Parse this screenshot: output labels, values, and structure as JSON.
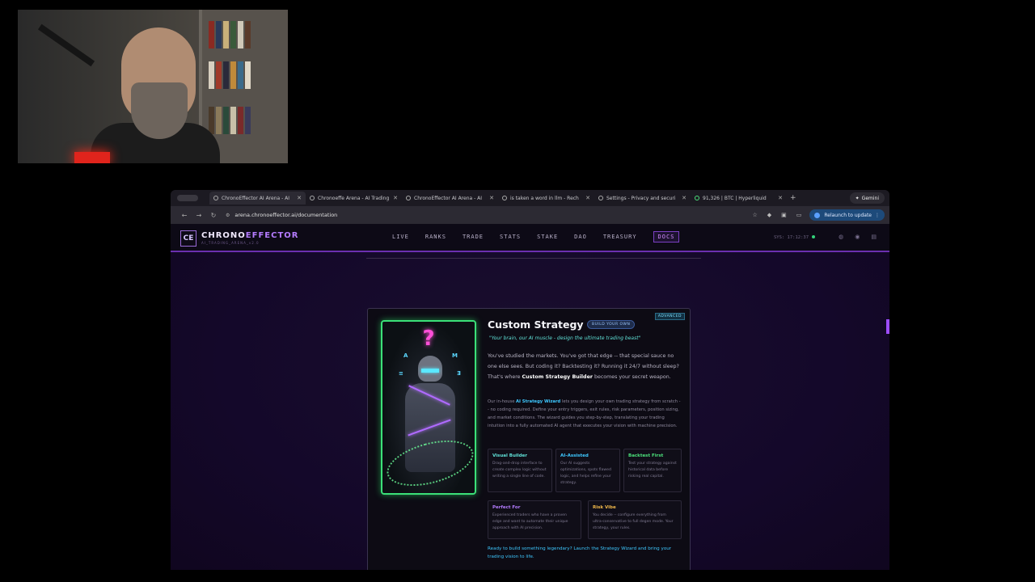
{
  "browser": {
    "tabs": [
      {
        "title": "ChronoEffector AI Arena - AI",
        "active": true
      },
      {
        "title": "Chronoeffe Arena - AI Trading",
        "active": false
      },
      {
        "title": "ChronoEffector AI Arena - AI",
        "active": false
      },
      {
        "title": "is taken a word in llm - Rech",
        "active": false
      },
      {
        "title": "Settings - Privacy and securi",
        "active": false
      },
      {
        "title": "91,326 | BTC | Hyperliquid",
        "active": false
      }
    ],
    "new_tab": "+",
    "gemini_label": "Gemini",
    "url": "arena.chronoeffector.ai/documentation",
    "relaunch_label": "Relaunch to update"
  },
  "site": {
    "logo_mark": "CE",
    "logo_main": "CHRONO",
    "logo_accent": "EFFECTOR",
    "logo_sub": "AI_TRADING_ARENA_v2.0",
    "menu": [
      "LIVE",
      "RANKS",
      "TRADE",
      "STATS",
      "STAKE",
      "DAO",
      "TREASURY",
      "DOCS"
    ],
    "active_menu": "DOCS",
    "sys_time": "SYS: 17:12:37"
  },
  "card": {
    "level_badge": "ADVANCED",
    "title": "Custom Strategy",
    "title_badge": "BUILD YOUR OWN",
    "tagline": "\"Your brain, our AI muscle - design the ultimate trading beast\"",
    "intro_1": "You've studied the markets. You've got that edge -- that special sauce no one else sees. But coding it? Backtesting it? Running it 24/7 without sleep? That's where ",
    "intro_bold": "Custom Strategy Builder",
    "intro_2": " becomes your secret weapon.",
    "wizard_1": "Our in-house ",
    "wizard_bold": "AI Strategy Wizard",
    "wizard_2": " lets you design your own trading strategy from scratch -- no coding required. Define your entry triggers, exit rules, risk parameters, position sizing, and market conditions. The wizard guides you step-by-step, translating your trading intuition into a fully automated AI agent that executes your vision with machine precision.",
    "features": [
      {
        "title": "Visual Builder",
        "desc": "Drag-and-drop interface to create complex logic without writing a single line of code.",
        "color": "#5fe0d6"
      },
      {
        "title": "AI-Assisted",
        "desc": "Our AI suggests optimizations, spots flawed logic, and helps refine your strategy.",
        "color": "#3ec8ff"
      },
      {
        "title": "Backtest First",
        "desc": "Test your strategy against historical data before risking real capital.",
        "color": "#4be07a"
      },
      {
        "title": "Perfect For",
        "desc": "Experienced traders who have a proven edge and want to automate their unique approach with AI precision.",
        "color": "#b57cff"
      },
      {
        "title": "Risk Vibe",
        "desc": "You decide -- configure everything from ultra-conservative to full degen mode. Your strategy, your rules.",
        "color": "#f0b84a"
      }
    ],
    "cta": "Ready to build something legendary? Launch the Strategy Wizard and bring your trading vision to life."
  }
}
